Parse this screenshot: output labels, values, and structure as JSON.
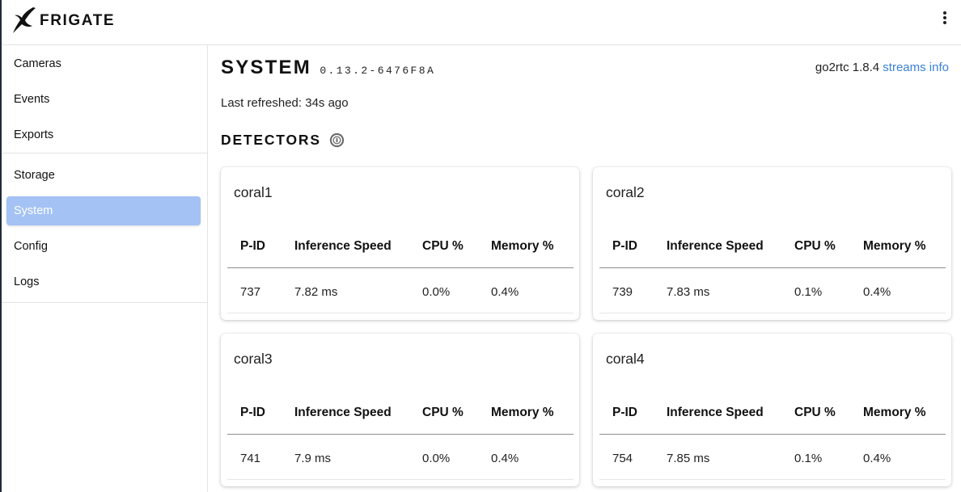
{
  "header": {
    "brand": "FRIGATE"
  },
  "sidebar": {
    "items": [
      {
        "label": "Cameras"
      },
      {
        "label": "Events"
      },
      {
        "label": "Exports"
      },
      {
        "label": "Storage"
      },
      {
        "label": "System"
      },
      {
        "label": "Config"
      },
      {
        "label": "Logs"
      }
    ],
    "active": "System"
  },
  "main": {
    "title": "SYSTEM",
    "version": "0.13.2-6476F8A",
    "go2rtc_text": "go2rtc 1.8.4",
    "go2rtc_link": "streams info",
    "last_refreshed": "Last refreshed: 34s ago",
    "section_title": "DETECTORS"
  },
  "table_headers": [
    "P-ID",
    "Inference Speed",
    "CPU %",
    "Memory %"
  ],
  "detectors": [
    {
      "name": "coral1",
      "pid": "737",
      "inference": "7.82 ms",
      "cpu": "0.0%",
      "memory": "0.4%"
    },
    {
      "name": "coral2",
      "pid": "739",
      "inference": "7.83 ms",
      "cpu": "0.1%",
      "memory": "0.4%"
    },
    {
      "name": "coral3",
      "pid": "741",
      "inference": "7.9 ms",
      "cpu": "0.0%",
      "memory": "0.4%"
    },
    {
      "name": "coral4",
      "pid": "754",
      "inference": "7.85 ms",
      "cpu": "0.1%",
      "memory": "0.4%"
    }
  ],
  "colors": {
    "accent_active": "#a4c2f4",
    "link": "#3b82d6"
  },
  "icons": {
    "logo": "frigate-bird-logo",
    "menu": "kebab-menu-icon",
    "info": "info-icon"
  }
}
